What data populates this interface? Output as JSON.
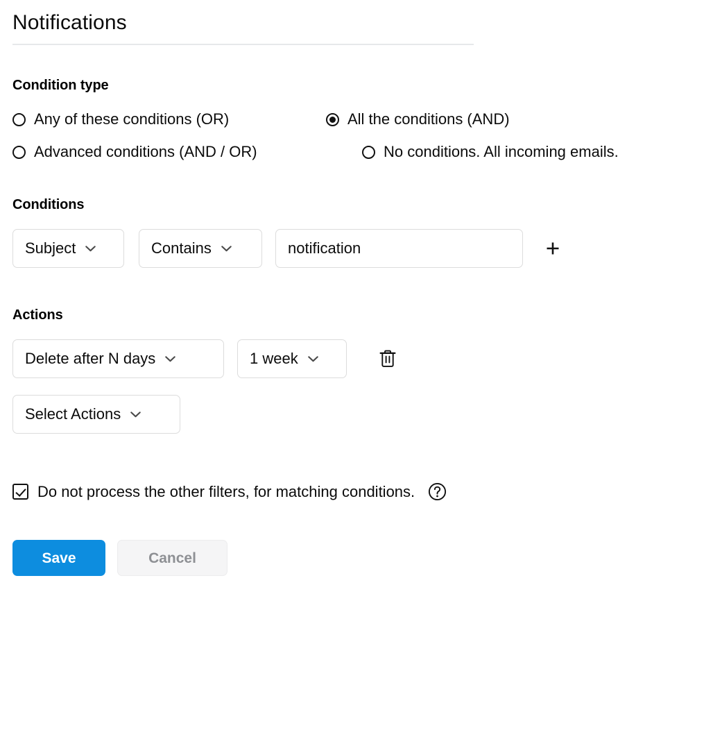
{
  "header": {
    "title": "Notifications"
  },
  "condition_type": {
    "section_label": "Condition type",
    "options": [
      {
        "label": "Any of these conditions (OR)",
        "selected": false
      },
      {
        "label": "All the conditions (AND)",
        "selected": true
      },
      {
        "label": "Advanced conditions (AND / OR)",
        "selected": false
      },
      {
        "label": "No conditions. All incoming emails.",
        "selected": false
      }
    ]
  },
  "conditions": {
    "section_label": "Conditions",
    "row": {
      "field": "Subject",
      "operator": "Contains",
      "value": "notification",
      "value_placeholder": ""
    },
    "add_icon": "plus-icon"
  },
  "actions": {
    "section_label": "Actions",
    "row": {
      "action": "Delete after N days",
      "period": "1 week",
      "delete_icon": "trash-icon"
    },
    "add_row": {
      "action": "Select Actions"
    }
  },
  "stop_processing": {
    "label": "Do not process the other filters, for matching conditions.",
    "checked": true,
    "help_icon": "question-circle-icon"
  },
  "footer": {
    "save_label": "Save",
    "cancel_label": "Cancel"
  },
  "colors": {
    "accent": "#0d8ddf",
    "cancel_bg": "#f5f5f6",
    "cancel_text": "#8e9094",
    "border": "#dcdcdc",
    "divider": "#e6e8ea"
  }
}
